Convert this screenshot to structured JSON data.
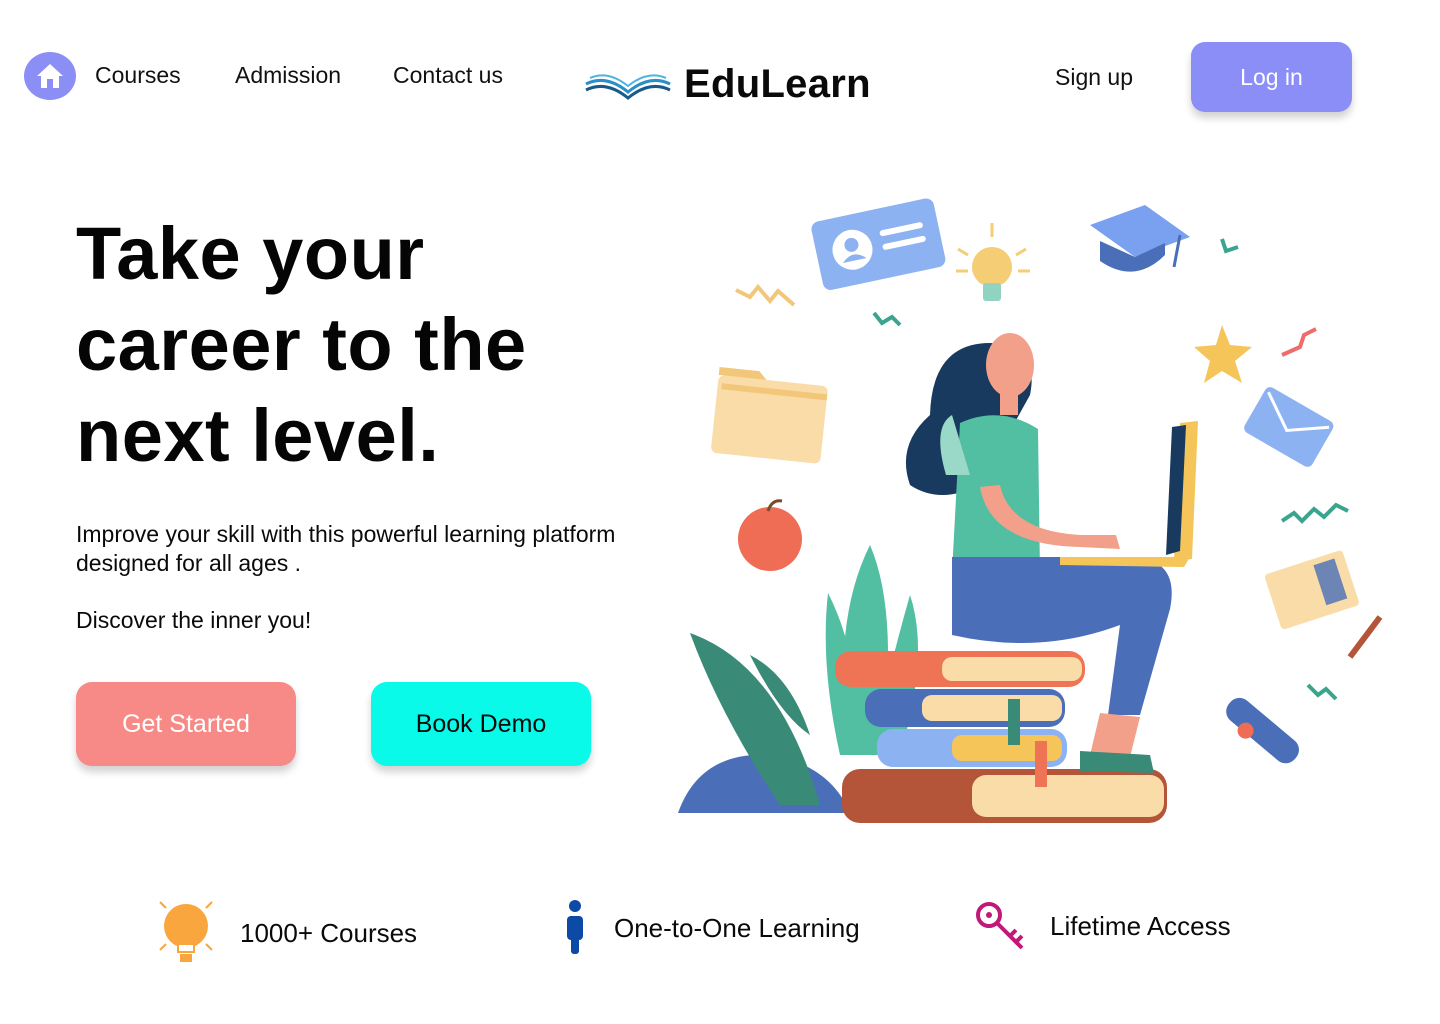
{
  "nav": {
    "links": [
      "Courses",
      "Admission",
      "Contact us"
    ],
    "brand_name": "EduLearn",
    "signup_label": "Sign up",
    "login_label": "Log in"
  },
  "hero": {
    "title_lines": [
      "Take your",
      "career to the",
      "next level."
    ],
    "subtitle": "Improve your skill with this powerful learning platform designed for all ages .",
    "tagline": "Discover the inner you!",
    "primary_cta": "Get Started",
    "secondary_cta": "Book Demo"
  },
  "features": [
    {
      "icon": "lightbulb-icon",
      "label": "1000+ Courses",
      "color": "#f9a63f"
    },
    {
      "icon": "person-icon",
      "label": "One-to-One Learning",
      "color": "#0c4aa6"
    },
    {
      "icon": "key-icon",
      "label": "Lifetime Access",
      "color": "#c2187a"
    }
  ],
  "colors": {
    "accent": "#8a8ef6",
    "get_started": "#f78a87",
    "book_demo": "#0afaea"
  }
}
